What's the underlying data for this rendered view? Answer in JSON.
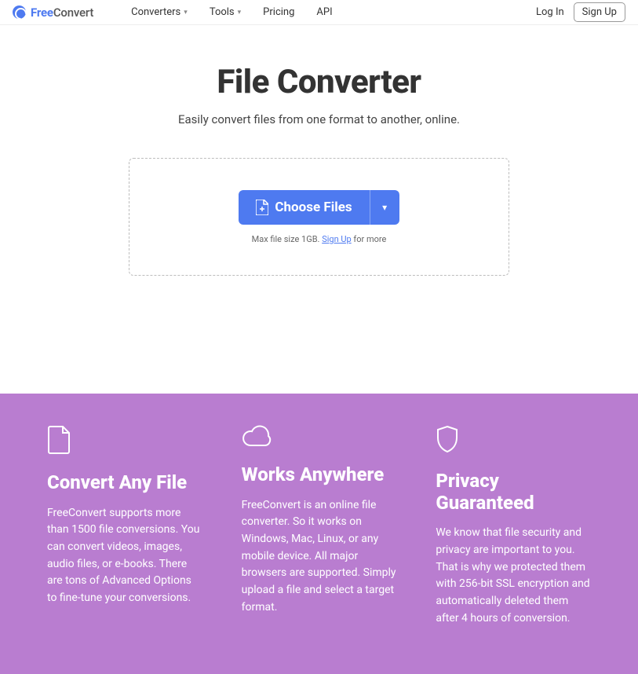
{
  "brand": {
    "part1": "Free",
    "part2": "Convert"
  },
  "nav": {
    "converters": "Converters",
    "tools": "Tools",
    "pricing": "Pricing",
    "api": "API"
  },
  "auth": {
    "login": "Log In",
    "signup": "Sign Up"
  },
  "hero": {
    "title": "File Converter",
    "subtitle": "Easily convert files from one format to another, online."
  },
  "drop": {
    "choose": "Choose Files",
    "limit_prefix": "Max file size 1GB. ",
    "limit_link": "Sign Up",
    "limit_suffix": " for more"
  },
  "features": {
    "any": {
      "title": "Convert Any File",
      "body": "FreeConvert supports more than 1500 file conversions. You can convert videos, images, audio files, or e-books. There are tons of Advanced Options to fine-tune your conversions."
    },
    "anywhere": {
      "title": "Works Anywhere",
      "body": "FreeConvert is an online file converter. So it works on Windows, Mac, Linux, or any mobile device. All major browsers are supported. Simply upload a file and select a target format."
    },
    "privacy": {
      "title": "Privacy Guaranteed",
      "body": "We know that file security and privacy are important to you. That is why we protected them with 256-bit SSL encryption and automatically deleted them after 4 hours of conversion."
    }
  }
}
